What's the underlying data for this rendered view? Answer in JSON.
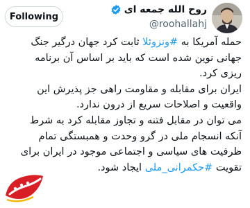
{
  "author": {
    "display_name": "روح الله جمعه ای",
    "handle": "@roohallahj",
    "verified": true
  },
  "follow_button": {
    "label": "Following"
  },
  "tweet": {
    "line1_pre": "حمله آمریکا به ",
    "line1_hashtag": "#ونزوئلا",
    "line1_post": " ثابت کرد جهان درگیر جنگ",
    "line2": "جهانی نوین شده است که باید بر اساس آن برنامه",
    "line3": "ریزی کرد.",
    "line4": "ایران برای مقابله و مقاومت راهی جز پذیرش این",
    "line5": "واقعیت و اصلاحات سریع از درون ندارد.",
    "line6": "می توان در مقابل فتنه و تجاوز مقابله کرد به شرط",
    "line7": "آنکه انسجام ملی در گرو وحدت و همبستگی تمام",
    "line8": "ظرفیت های سیاسی و اجتماعی موجود در ایران برای",
    "line9_pre": "تقویت ",
    "line9_hashtag": "#حکمرانی_ملی",
    "line9_post": " ایجاد شود."
  },
  "colors": {
    "link": "#1d9bf0",
    "verified": "#1d9bf0",
    "logo_red": "#d81f26"
  },
  "icons": [
    "verified-badge-icon",
    "avatar",
    "kebab-logo"
  ]
}
